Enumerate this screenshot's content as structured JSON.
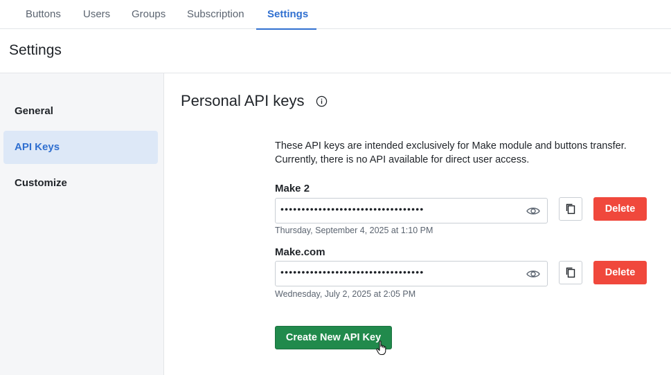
{
  "tabs": [
    {
      "label": "Buttons"
    },
    {
      "label": "Users"
    },
    {
      "label": "Groups"
    },
    {
      "label": "Subscription"
    },
    {
      "label": "Settings",
      "active": true
    }
  ],
  "page": {
    "title": "Settings"
  },
  "sidebar": {
    "items": [
      {
        "label": "General"
      },
      {
        "label": "API Keys",
        "active": true
      },
      {
        "label": "Customize"
      }
    ]
  },
  "main": {
    "section_title": "Personal API keys",
    "description_line1": "These API keys are intended exclusively for Make module and buttons transfer.",
    "description_line2": "Currently, there is no API available for direct user access.",
    "keys": [
      {
        "name": "Make 2",
        "masked_value": "••••••••••••••••••••••••••••••••••",
        "created": "Thursday, September 4, 2025 at 1:10 PM",
        "delete_label": "Delete"
      },
      {
        "name": "Make.com",
        "masked_value": "••••••••••••••••••••••••••••••••••",
        "created": "Wednesday, July 2, 2025 at 2:05 PM",
        "delete_label": "Delete"
      }
    ],
    "create_label": "Create New API Key"
  },
  "colors": {
    "accent": "#2f6fd0",
    "delete": "#f0483c",
    "create": "#218a4c"
  },
  "icons": [
    "info-icon",
    "eye-icon",
    "copy-icon",
    "hand-cursor-icon"
  ]
}
